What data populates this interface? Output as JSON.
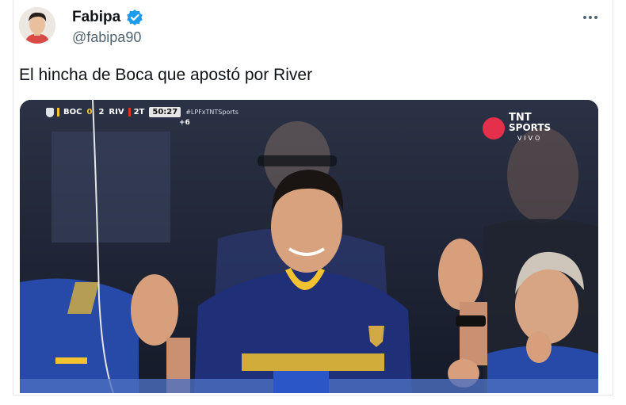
{
  "author": {
    "name": "Fabipa",
    "handle": "@fabipa90",
    "verified_icon": "verified-badge-icon",
    "avatar_icon": "avatar"
  },
  "menu": {
    "icon": "more-options-icon"
  },
  "tweet": {
    "text": "El hincha de Boca que apostó por River"
  },
  "media": {
    "scorebug": {
      "home": "BOC",
      "home_score": "0",
      "away_score": "2",
      "away": "RIV",
      "period": "2T",
      "clock": "50:27",
      "hashtag": "#LPFxTNTSports",
      "added_time": "+6"
    },
    "broadcaster": {
      "line1": "TNT",
      "line2": "SPORTS",
      "line3": "VIVO"
    }
  },
  "colors": {
    "accent": "#1d9bf0",
    "boca_blue": "#1b2a78",
    "boca_yellow": "#f2c230",
    "tnt_red": "#e4304b"
  }
}
